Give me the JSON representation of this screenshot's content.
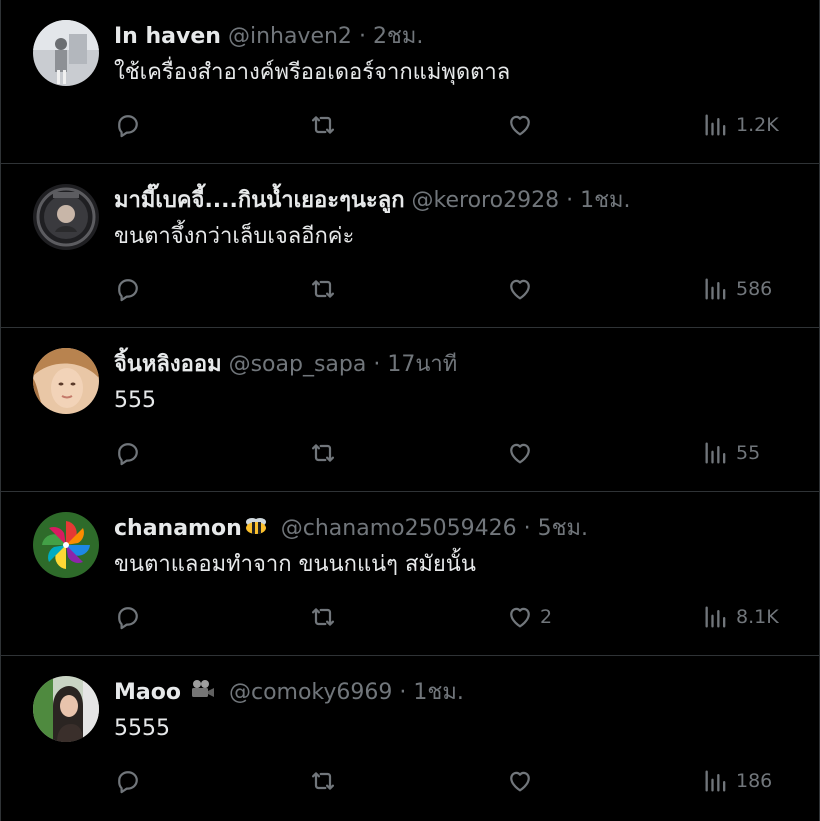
{
  "colors": {
    "background": "#000000",
    "text_primary": "#e7e9ea",
    "text_secondary": "#71767b",
    "divider": "#2f3336"
  },
  "tweets": [
    {
      "name": "In haven",
      "handle": "@inhaven2",
      "dot": "·",
      "time": "2ชม.",
      "text": "ใช้เครื่องสำอางค์พรีออเดอร์จากแม่พุดตาล",
      "likes": "",
      "views": "1.2K",
      "avatar": "photo-avatar"
    },
    {
      "name": "มามี๊เบคจี้....กินน้ำเยอะๆนะลูก",
      "handle": "@keroro2928",
      "dot": "·",
      "time": "1ชม.",
      "text": "ขนตาจึ้งกว่าเล็บเจลอีกค่ะ",
      "likes": "",
      "views": "586",
      "avatar": "logo-avatar"
    },
    {
      "name": "จิ้นหลิงออม",
      "handle": "@soap_sapa",
      "dot": "·",
      "time": "17นาที",
      "text": "555",
      "likes": "",
      "views": "55",
      "avatar": "photo-avatar"
    },
    {
      "name": "chanamon",
      "name_emoji": "bee-icon",
      "handle": "@chanamo25059426",
      "dot": "·",
      "time": "5ชม.",
      "text": "ขนตาแลอมทำจาก ขนนกแน่ๆ สมัยนั้น",
      "likes": "2",
      "views": "8.1K",
      "avatar": "pinwheel-avatar"
    },
    {
      "name": "Maoo",
      "name_emoji": "movie-camera-icon",
      "handle": "@comoky6969",
      "dot": "·",
      "time": "1ชม.",
      "text": "5555",
      "likes": "",
      "views": "186",
      "avatar": "photo-avatar"
    }
  ]
}
